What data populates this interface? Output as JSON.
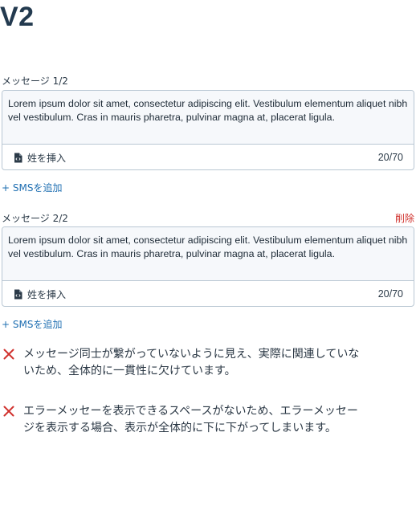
{
  "title": "V2",
  "messages": [
    {
      "label": "メッセージ 1/2",
      "text": "Lorem ipsum dolor sit amet, consectetur adipiscing elit. Vestibulum elementum aliquet nibh vel vestibulum. Cras in mauris pharetra, pulvinar magna at, placerat ligula.",
      "insert_label": "姓を挿入",
      "counter": "20/70",
      "add_label": "+ SMSを追加"
    },
    {
      "label": "メッセージ 2/2",
      "delete_label": "削除",
      "text": "Lorem ipsum dolor sit amet, consectetur adipiscing elit. Vestibulum elementum aliquet nibh vel vestibulum. Cras in mauris pharetra, pulvinar magna at, placerat ligula.",
      "insert_label": "姓を挿入",
      "counter": "20/70",
      "add_label": "+ SMSを追加"
    }
  ],
  "notes": [
    {
      "icon": "close-icon",
      "text": "メッセージ同士が繋がっていないように見え、実際に関連していないため、全体的に一貫性に欠けています。"
    },
    {
      "icon": "close-icon",
      "text": "エラーメッセーを表示できるスペースがないため、エラーメッセージを表示する場合、表示が全体的に下に下がってしまいます。"
    }
  ],
  "colors": {
    "accent": "#1f6fb2",
    "danger": "#d0312d",
    "heading": "#233a4f",
    "border": "#b9c7d3"
  }
}
